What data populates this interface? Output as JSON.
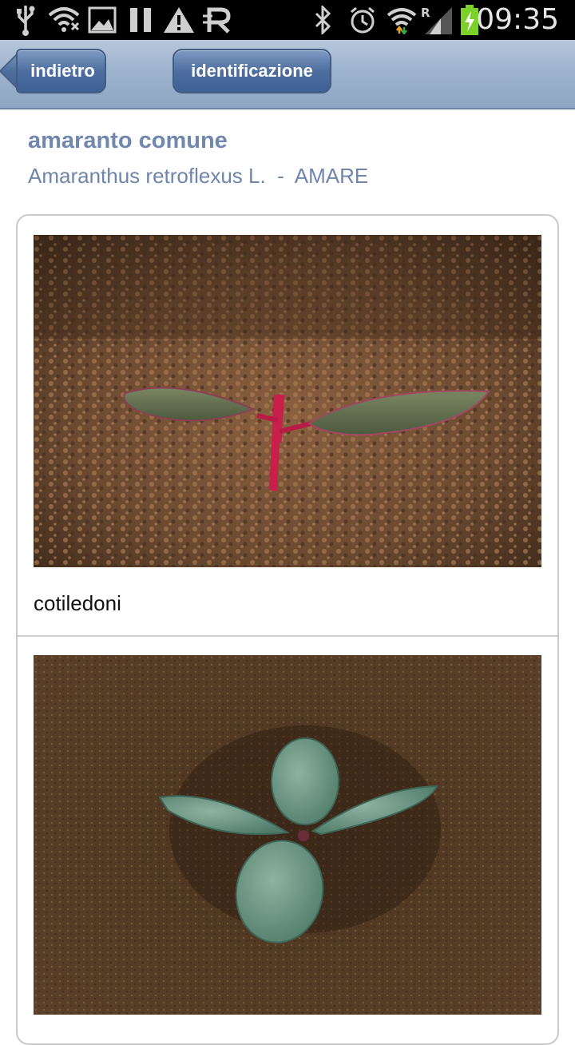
{
  "status_bar": {
    "time": "09:35",
    "roaming_indicator": "R",
    "icons": [
      "usb-icon",
      "wifi-hotspot-icon",
      "image-icon",
      "pause-icon",
      "warning-icon",
      "r-app-icon",
      "bluetooth-icon",
      "alarm-icon",
      "wifi-icon",
      "signal-icon",
      "battery-charging-icon"
    ]
  },
  "header": {
    "back_label": "indietro",
    "identification_label": "identificazione"
  },
  "plant": {
    "common_name": "amaranto comune",
    "scientific_name": "Amaranthus retroflexus L.  -  AMARE"
  },
  "images": [
    {
      "caption": "cotiledoni"
    },
    {
      "caption": ""
    }
  ],
  "colors": {
    "header_bar": "#9db3cd",
    "button_blue": "#4d6e9f",
    "title_text": "#7088ae"
  }
}
